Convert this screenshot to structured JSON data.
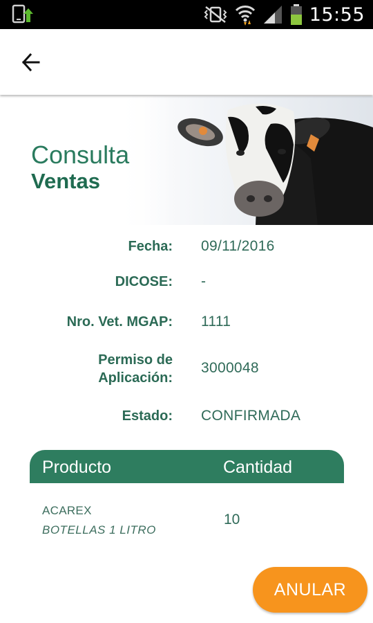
{
  "status_bar": {
    "time": "15:55",
    "icons": [
      "app-update-icon",
      "vibrate-mute-icon",
      "wifi-icon",
      "signal-icon",
      "battery-icon"
    ]
  },
  "app_bar": {
    "back_icon": "arrow-left-icon"
  },
  "hero": {
    "title_line1": "Consulta",
    "title_line2": "Ventas",
    "image": "cow-photo"
  },
  "details": [
    {
      "label": "Fecha:",
      "value": "09/11/2016"
    },
    {
      "label": "DICOSE:",
      "value": "-"
    },
    {
      "label": "Nro. Vet. MGAP:",
      "value": "1111"
    },
    {
      "label_line1": "Permiso de",
      "label_line2": "Aplicación:",
      "value": "3000048"
    },
    {
      "label": "Estado:",
      "value": "CONFIRMADA"
    }
  ],
  "table": {
    "headers": [
      "Producto",
      "Cantidad"
    ],
    "rows": [
      {
        "product": "ACAREX",
        "unit": "BOTELLAS 1 LITRO",
        "quantity": "10"
      }
    ]
  },
  "actions": {
    "cancel_label": "ANULAR"
  },
  "colors": {
    "primary_green": "#2e7d5f",
    "accent_orange": "#f7941d",
    "status_bar": "#000000"
  }
}
